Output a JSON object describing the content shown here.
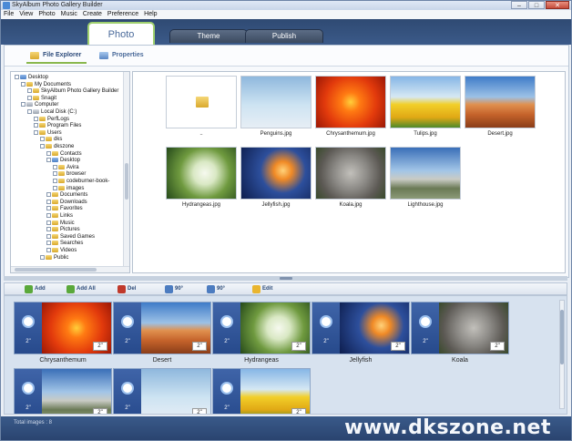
{
  "window": {
    "title": "SkyAlbum Photo Gallery Builder"
  },
  "menu": [
    "File",
    "View",
    "Photo",
    "Music",
    "Create",
    "Preference",
    "Help"
  ],
  "tabs": [
    {
      "label": "Photo",
      "active": true
    },
    {
      "label": "Theme",
      "active": false
    },
    {
      "label": "Publish",
      "active": false
    }
  ],
  "subtabs": {
    "explorer": "File Explorer",
    "properties": "Properties"
  },
  "tree": [
    {
      "label": "Desktop",
      "level": 0,
      "icon": "blue"
    },
    {
      "label": "My Documents",
      "level": 1,
      "icon": "folder"
    },
    {
      "label": "SkyAlbum Photo Gallery Builder",
      "level": 2,
      "icon": "folder"
    },
    {
      "label": "Snagit",
      "level": 2,
      "icon": "folder"
    },
    {
      "label": "Computer",
      "level": 1,
      "icon": "grey"
    },
    {
      "label": "Local Disk (C:)",
      "level": 2,
      "icon": "grey"
    },
    {
      "label": "PerfLogs",
      "level": 3,
      "icon": "folder"
    },
    {
      "label": "Program Files",
      "level": 3,
      "icon": "folder"
    },
    {
      "label": "Users",
      "level": 3,
      "icon": "folder"
    },
    {
      "label": "dks",
      "level": 4,
      "icon": "folder"
    },
    {
      "label": "dkszone",
      "level": 4,
      "icon": "folder"
    },
    {
      "label": "Contacts",
      "level": 5,
      "icon": "folder"
    },
    {
      "label": "Desktop",
      "level": 5,
      "icon": "blue"
    },
    {
      "label": "Avira",
      "level": 6,
      "icon": "folder"
    },
    {
      "label": "browser",
      "level": 6,
      "icon": "folder"
    },
    {
      "label": "codeburner-book-",
      "level": 6,
      "icon": "folder"
    },
    {
      "label": "images",
      "level": 6,
      "icon": "folder"
    },
    {
      "label": "Documents",
      "level": 5,
      "icon": "folder"
    },
    {
      "label": "Downloads",
      "level": 5,
      "icon": "folder"
    },
    {
      "label": "Favorites",
      "level": 5,
      "icon": "folder"
    },
    {
      "label": "Links",
      "level": 5,
      "icon": "folder"
    },
    {
      "label": "Music",
      "level": 5,
      "icon": "folder"
    },
    {
      "label": "Pictures",
      "level": 5,
      "icon": "folder"
    },
    {
      "label": "Saved Games",
      "level": 5,
      "icon": "folder"
    },
    {
      "label": "Searches",
      "level": 5,
      "icon": "folder"
    },
    {
      "label": "Videos",
      "level": 5,
      "icon": "folder"
    },
    {
      "label": "Public",
      "level": 4,
      "icon": "folder"
    }
  ],
  "files": [
    {
      "name": "..",
      "img": "folder"
    },
    {
      "name": "Penguins.jpg",
      "img": "penguins"
    },
    {
      "name": "Chrysanthemum.jpg",
      "img": "chrys"
    },
    {
      "name": "Tulips.jpg",
      "img": "tulips"
    },
    {
      "name": "Desert.jpg",
      "img": "desert"
    },
    {
      "name": "Hydrangeas.jpg",
      "img": "hydr"
    },
    {
      "name": "Jellyfish.jpg",
      "img": "jelly"
    },
    {
      "name": "Koala.jpg",
      "img": "koala"
    },
    {
      "name": "Lighthouse.jpg",
      "img": "light"
    }
  ],
  "toolbar": {
    "add": "Add",
    "add_all": "Add All",
    "del": "Del",
    "rotate_left": "90°",
    "rotate_right": "90°",
    "edit": "Edit"
  },
  "slides": [
    {
      "caption": "Chrysanthemum",
      "img": "chrys",
      "trans": "2\"",
      "dur": "2\""
    },
    {
      "caption": "Desert",
      "img": "desert",
      "trans": "2\"",
      "dur": "2\""
    },
    {
      "caption": "Hydrangeas",
      "img": "hydr",
      "trans": "2\"",
      "dur": "2\""
    },
    {
      "caption": "Jellyfish",
      "img": "jelly",
      "trans": "2\"",
      "dur": "2\""
    },
    {
      "caption": "Koala",
      "img": "koala",
      "trans": "2\"",
      "dur": "2\""
    },
    {
      "caption": "",
      "img": "light",
      "trans": "2\"",
      "dur": "2\""
    },
    {
      "caption": "",
      "img": "penguins",
      "trans": "2\"",
      "dur": "2\""
    },
    {
      "caption": "",
      "img": "tulips",
      "trans": "2\"",
      "dur": "2\""
    }
  ],
  "status": {
    "total": "Total images : 8"
  },
  "watermark": "www.dkszone.net"
}
